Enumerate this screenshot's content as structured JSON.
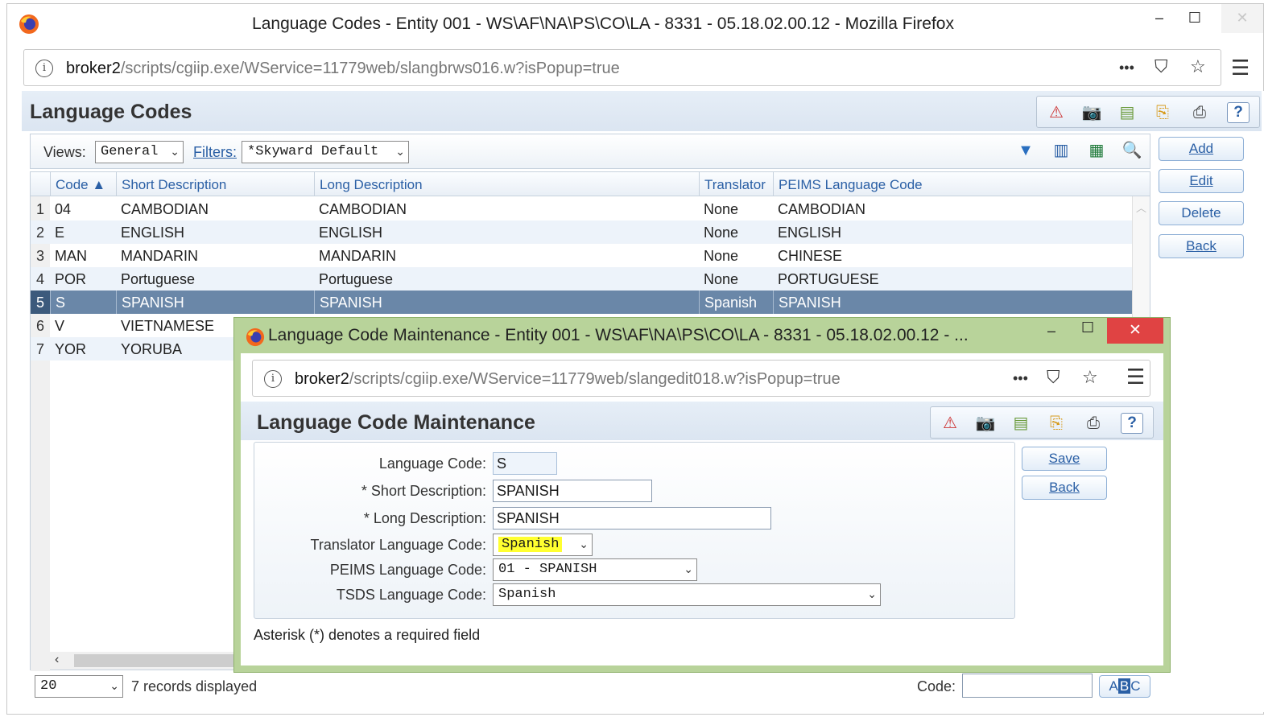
{
  "browser": {
    "title": "Language Codes - Entity 001 - WS\\AF\\NA\\PS\\CO\\LA - 8331 - 05.18.02.00.12 - Mozilla Firefox",
    "url_host": "broker2",
    "url_path": "/scripts/cgiip.exe/WService=11779web/slangbrws016.w?isPopup=true",
    "controls": {
      "minimize": "–",
      "maximize": "☐",
      "close": "✕",
      "more": "•••",
      "pocket": "⛉",
      "star": "☆",
      "menu": "☰"
    }
  },
  "page": {
    "title": "Language Codes",
    "views_label": "Views:",
    "views_value": "General",
    "filters_label": "Filters:",
    "filters_value": "*Skyward Default",
    "side_buttons": [
      "Add",
      "Edit",
      "Delete",
      "Back"
    ]
  },
  "grid": {
    "columns": [
      "Code ▲",
      "Short Description",
      "Long Description",
      "Translator",
      "PEIMS Language Code"
    ],
    "rows": [
      {
        "num": "1",
        "code": "04",
        "short": "CAMBODIAN",
        "long": "CAMBODIAN",
        "translator": "None",
        "peims": "CAMBODIAN"
      },
      {
        "num": "2",
        "code": "E",
        "short": "ENGLISH",
        "long": "ENGLISH",
        "translator": "None",
        "peims": "ENGLISH"
      },
      {
        "num": "3",
        "code": "MAN",
        "short": "MANDARIN",
        "long": "MANDARIN",
        "translator": "None",
        "peims": "CHINESE"
      },
      {
        "num": "4",
        "code": "POR",
        "short": "Portuguese",
        "long": "Portuguese",
        "translator": "None",
        "peims": "PORTUGUESE"
      },
      {
        "num": "5",
        "code": "S",
        "short": "SPANISH",
        "long": "SPANISH",
        "translator": "Spanish",
        "peims": "SPANISH"
      },
      {
        "num": "6",
        "code": "V",
        "short": "VIETNAMESE",
        "long": "",
        "translator": "",
        "peims": ""
      },
      {
        "num": "7",
        "code": "YOR",
        "short": "YORUBA",
        "long": "",
        "translator": "",
        "peims": ""
      }
    ],
    "selected_row": 5
  },
  "footer": {
    "page_size": "20",
    "records_text": "7 records displayed",
    "code_label": "Code:",
    "abc_a": "A",
    "abc_b": "B",
    "abc_c": "C"
  },
  "popup": {
    "title": "Language Code Maintenance - Entity 001 - WS\\AF\\NA\\PS\\CO\\LA - 8331 - 05.18.02.00.12 - ...",
    "url_host": "broker2",
    "url_path": "/scripts/cgiip.exe/WService=11779web/slangedit018.w?isPopup=true",
    "heading": "Language Code Maintenance",
    "fields": {
      "language_code_label": "Language Code:",
      "language_code_value": "S",
      "short_desc_label": "* Short Description:",
      "short_desc_value": "SPANISH",
      "long_desc_label": "* Long Description:",
      "long_desc_value": "SPANISH",
      "translator_label": "Translator Language Code:",
      "translator_value": "Spanish",
      "peims_label": "PEIMS Language Code:",
      "peims_value": "01 - SPANISH",
      "tsds_label": "TSDS Language Code:",
      "tsds_value": "Spanish"
    },
    "save_label": "Save",
    "back_label": "Back",
    "note": "Asterisk (*) denotes a required field"
  },
  "colors": {
    "highlight": "#ffff30",
    "selected_row": "#6a87a8",
    "link": "#2a5fa5",
    "popup_border": "#b8d39a",
    "close_red": "#e04343"
  }
}
